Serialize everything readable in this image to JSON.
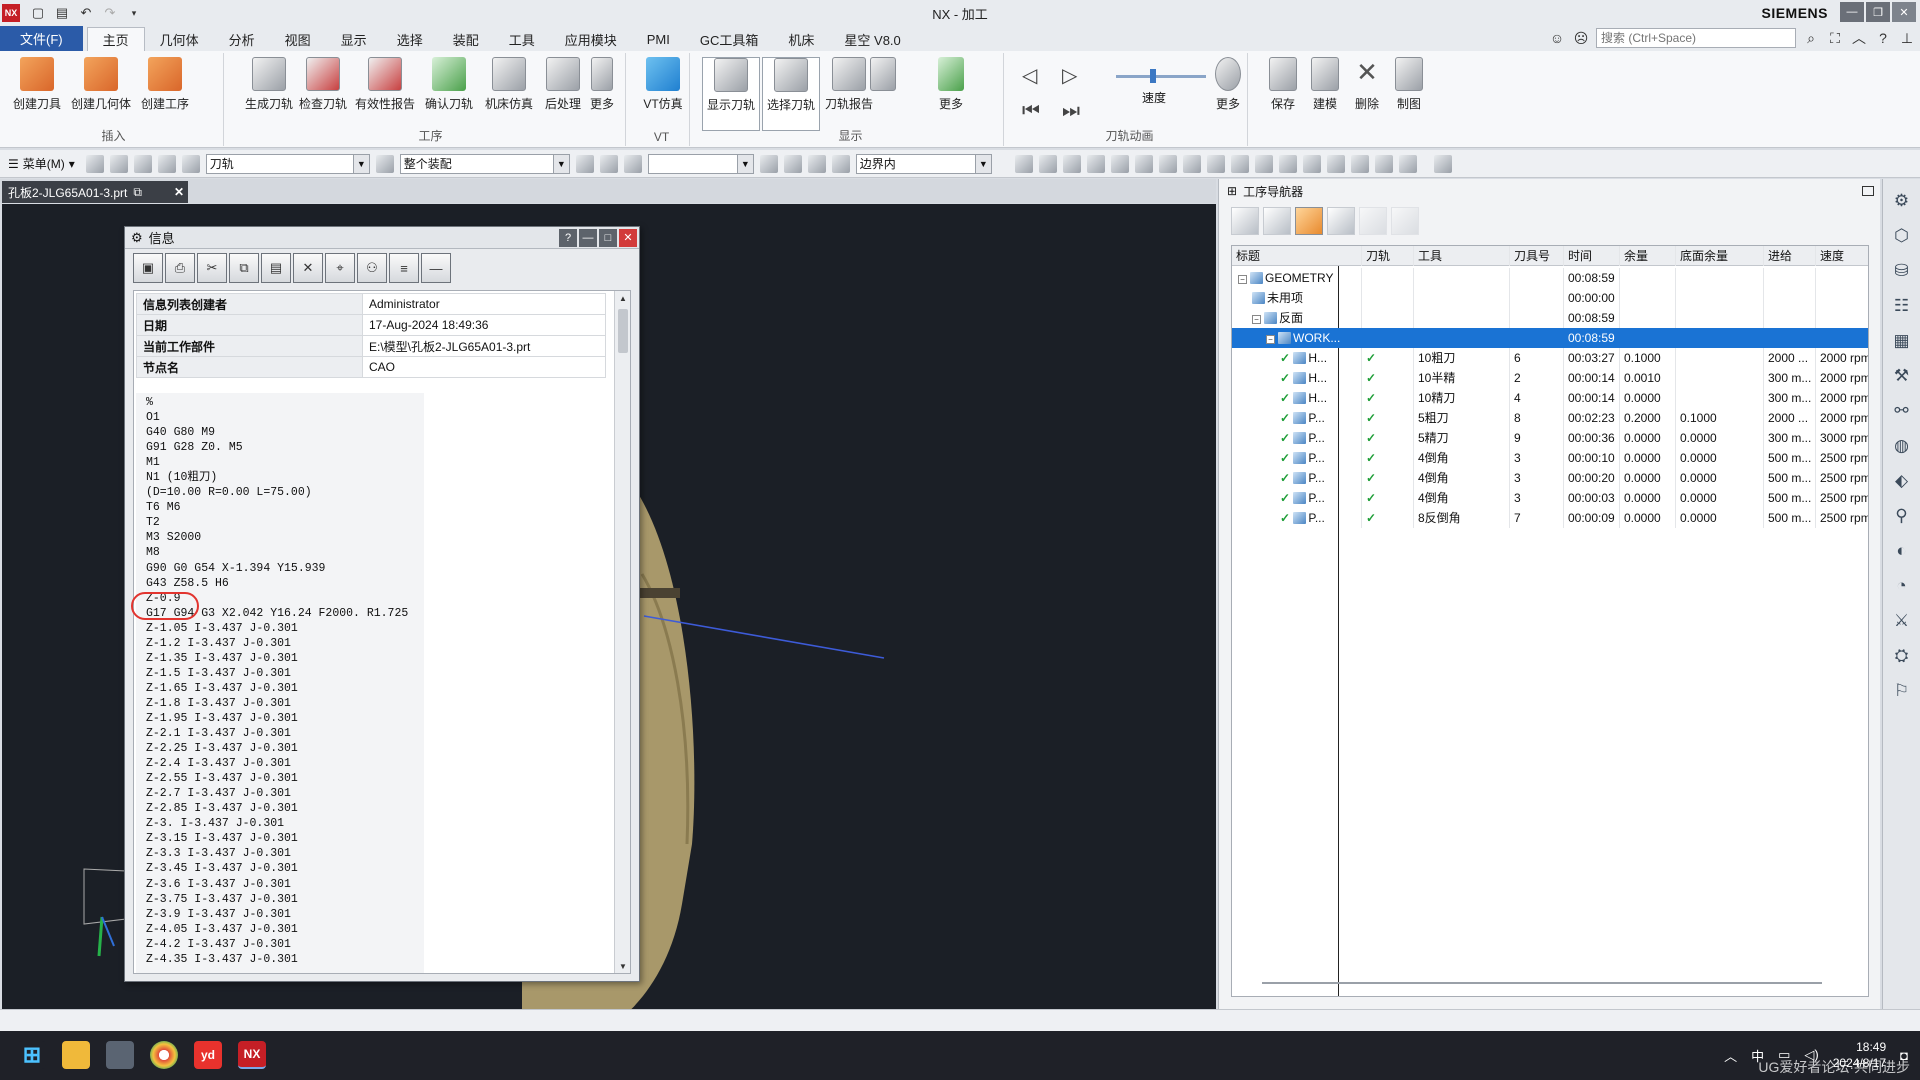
{
  "titlebar": {
    "title": "NX - 加工",
    "brand": "SIEMENS",
    "logo": "NX"
  },
  "ribbon_tabs": [
    "文件(F)",
    "主页",
    "几何体",
    "分析",
    "视图",
    "显示",
    "选择",
    "装配",
    "工具",
    "应用模块",
    "PMI",
    "GC工具箱",
    "机床",
    "星空 V8.0"
  ],
  "search": {
    "placeholder": "搜索 (Ctrl+Space)"
  },
  "ribbon": {
    "insert": {
      "label": "插入",
      "buttons": [
        "创建刀具",
        "创建几何体",
        "创建工序"
      ]
    },
    "operation": {
      "label": "工序",
      "buttons": [
        "生成刀轨",
        "检查刀轨",
        "有效性报告",
        "确认刀轨",
        "机床仿真",
        "后处理",
        "更多"
      ]
    },
    "vt": {
      "label": "VT",
      "buttons": [
        "VT仿真"
      ]
    },
    "display": {
      "label": "显示",
      "buttons": [
        "显示刀轨",
        "选择刀轨",
        "刀轨报告",
        "更多"
      ]
    },
    "animation": {
      "label": "刀轨动画",
      "speed_label": "速度",
      "more": "更多"
    },
    "extra": {
      "buttons": [
        "保存",
        "建模",
        "删除",
        "制图"
      ]
    }
  },
  "toolbar": {
    "menu": "菜单(M)",
    "filter": "刀轨",
    "scope": "整个装配",
    "boundary": "边界内"
  },
  "document_tab": "孔板2-JLG65A01-3.prt",
  "info_dialog": {
    "title": "信息",
    "rows": [
      {
        "k": "信息列表创建者",
        "v": "Administrator"
      },
      {
        "k": "日期",
        "v": "17-Aug-2024 18:49:36"
      },
      {
        "k": "当前工作部件",
        "v": "E:\\模型\\孔板2-JLG65A01-3.prt"
      },
      {
        "k": "节点名",
        "v": "CAO"
      }
    ],
    "code": "%\nO1\nG40 G80 M9\nG91 G28 Z0. M5\nM1\nN1 (10粗刀)\n(D=10.00 R=0.00 L=75.00)\nT6 M6\nT2\nM3 S2000\nM8\nG90 G0 G54 X-1.394 Y15.939\nG43 Z58.5 H6\nZ-0.9\nG17 G94 G3 X2.042 Y16.24 F2000. R1.725\nZ-1.05 I-3.437 J-0.301\nZ-1.2 I-3.437 J-0.301\nZ-1.35 I-3.437 J-0.301\nZ-1.5 I-3.437 J-0.301\nZ-1.65 I-3.437 J-0.301\nZ-1.8 I-3.437 J-0.301\nZ-1.95 I-3.437 J-0.301\nZ-2.1 I-3.437 J-0.301\nZ-2.25 I-3.437 J-0.301\nZ-2.4 I-3.437 J-0.301\nZ-2.55 I-3.437 J-0.301\nZ-2.7 I-3.437 J-0.301\nZ-2.85 I-3.437 J-0.301\nZ-3. I-3.437 J-0.301\nZ-3.15 I-3.437 J-0.301\nZ-3.3 I-3.437 J-0.301\nZ-3.45 I-3.437 J-0.301\nZ-3.6 I-3.437 J-0.301\nZ-3.75 I-3.437 J-0.301\nZ-3.9 I-3.437 J-0.301\nZ-4.05 I-3.437 J-0.301\nZ-4.2 I-3.437 J-0.301\nZ-4.35 I-3.437 J-0.301"
  },
  "op_navigator": {
    "title": "工序导航器",
    "columns": [
      "标题",
      "刀轨",
      "工具",
      "刀具号",
      "时间",
      "余量",
      "底面余量",
      "进给",
      "速度"
    ],
    "rows": [
      {
        "name": "GEOMETRY",
        "path": "",
        "tool": "",
        "num": "",
        "time": "00:08:59",
        "stock": "",
        "floor": "",
        "feed": "",
        "speed": "",
        "level": 0,
        "exp": "⊟"
      },
      {
        "name": "未用项",
        "path": "",
        "tool": "",
        "num": "",
        "time": "00:00:00",
        "stock": "",
        "floor": "",
        "feed": "",
        "speed": "",
        "level": 1,
        "exp": ""
      },
      {
        "name": "反面",
        "path": "",
        "tool": "",
        "num": "",
        "time": "00:08:59",
        "stock": "",
        "floor": "",
        "feed": "",
        "speed": "",
        "level": 1,
        "exp": "⊟"
      },
      {
        "name": "WORK...",
        "path": "",
        "tool": "",
        "num": "",
        "time": "00:08:59",
        "stock": "",
        "floor": "",
        "feed": "",
        "speed": "",
        "level": 2,
        "exp": "⊟",
        "selected": true
      },
      {
        "name": "H...",
        "path": "✓",
        "tool": "10粗刀",
        "num": "6",
        "time": "00:03:27",
        "stock": "0.1000",
        "floor": "",
        "feed": "2000 ...",
        "speed": "2000 rpm",
        "level": 3,
        "op": true
      },
      {
        "name": "H...",
        "path": "✓",
        "tool": "10半精",
        "num": "2",
        "time": "00:00:14",
        "stock": "0.0010",
        "floor": "",
        "feed": "300 m...",
        "speed": "2000 rpm",
        "level": 3,
        "op": true
      },
      {
        "name": "H...",
        "path": "✓",
        "tool": "10精刀",
        "num": "4",
        "time": "00:00:14",
        "stock": "0.0000",
        "floor": "",
        "feed": "300 m...",
        "speed": "2000 rpm",
        "level": 3,
        "op": true
      },
      {
        "name": "P...",
        "path": "✓",
        "tool": "5粗刀",
        "num": "8",
        "time": "00:02:23",
        "stock": "0.2000",
        "floor": "0.1000",
        "feed": "2000 ...",
        "speed": "2000 rpm",
        "level": 3,
        "op": true
      },
      {
        "name": "P...",
        "path": "✓",
        "tool": "5精刀",
        "num": "9",
        "time": "00:00:36",
        "stock": "0.0000",
        "floor": "0.0000",
        "feed": "300 m...",
        "speed": "3000 rpm",
        "level": 3,
        "op": true
      },
      {
        "name": "P...",
        "path": "✓",
        "tool": "4倒角",
        "num": "3",
        "time": "00:00:10",
        "stock": "0.0000",
        "floor": "0.0000",
        "feed": "500 m...",
        "speed": "2500 rpm",
        "level": 3,
        "op": true
      },
      {
        "name": "P...",
        "path": "✓",
        "tool": "4倒角",
        "num": "3",
        "time": "00:00:20",
        "stock": "0.0000",
        "floor": "0.0000",
        "feed": "500 m...",
        "speed": "2500 rpm",
        "level": 3,
        "op": true
      },
      {
        "name": "P...",
        "path": "✓",
        "tool": "4倒角",
        "num": "3",
        "time": "00:00:03",
        "stock": "0.0000",
        "floor": "0.0000",
        "feed": "500 m...",
        "speed": "2500 rpm",
        "level": 3,
        "op": true
      },
      {
        "name": "P...",
        "path": "✓",
        "tool": "8反倒角",
        "num": "7",
        "time": "00:00:09",
        "stock": "0.0000",
        "floor": "0.0000",
        "feed": "500 m...",
        "speed": "2500 rpm",
        "level": 3,
        "op": true
      }
    ]
  },
  "taskbar": {
    "ime": "中",
    "time": "18:49",
    "date": "2024/8/17",
    "watermark": "UG爱好者论坛·共同进步"
  },
  "colors": {
    "accent": "#2b5ba8",
    "selection": "#1a73d4",
    "viewport": "#1b1f26",
    "check": "#1e9e37"
  }
}
